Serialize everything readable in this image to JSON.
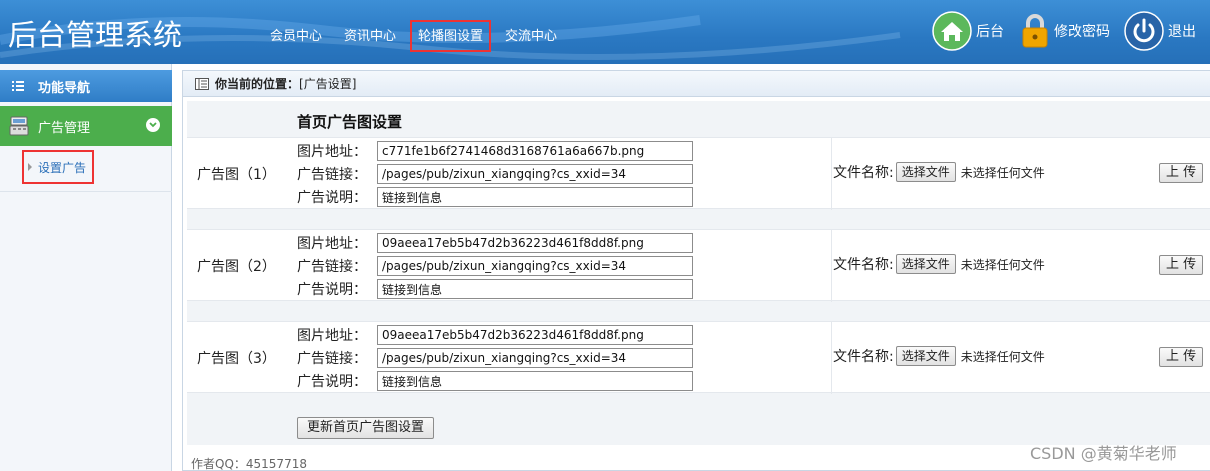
{
  "header": {
    "title": "后台管理系统",
    "nav": [
      "会员中心",
      "资讯中心",
      "轮播图设置",
      "交流中心"
    ],
    "active_nav": 2,
    "home_label": "后台",
    "password_label": "修改密码",
    "logout_label": "退出"
  },
  "sidebar": {
    "heading": "功能导航",
    "group_label": "广告管理",
    "sub_item": "设置广告"
  },
  "breadcrumb": {
    "prefix": "你当前的位置：",
    "current": "[广告设置]"
  },
  "section_title": "首页广告图设置",
  "field_labels": {
    "image": "图片地址：",
    "link": "广告链接：",
    "desc": "广告说明："
  },
  "file": {
    "label": "文件名称:",
    "choose_button": "选择文件",
    "no_file": "未选择任何文件",
    "upload_button": "上 传"
  },
  "ads": [
    {
      "label": "广告图（1）",
      "image": "c771fe1b6f2741468d3168761a6a667b.png",
      "link": "/pages/pub/zixun_xiangqing?cs_xxid=34",
      "desc": "链接到信息"
    },
    {
      "label": "广告图（2）",
      "image": "09aeea17eb5b47d2b36223d461f8dd8f.png",
      "link": "/pages/pub/zixun_xiangqing?cs_xxid=34",
      "desc": "链接到信息"
    },
    {
      "label": "广告图（3）",
      "image": "09aeea17eb5b47d2b36223d461f8dd8f.png",
      "link": "/pages/pub/zixun_xiangqing?cs_xxid=34",
      "desc": "链接到信息"
    }
  ],
  "update_button": "更新首页广告图设置",
  "footer": "作者QQ：45157718",
  "watermark": "CSDN @黄菊华老师"
}
